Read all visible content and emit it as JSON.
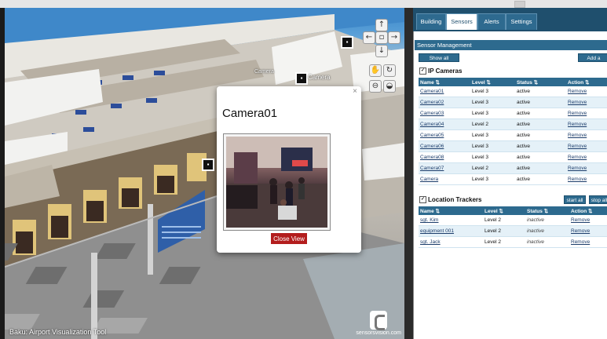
{
  "viewport": {
    "watermark": "Baku: Airport Visualization Tool",
    "brand": "sensorsvision.com",
    "camera_labels": [
      "Camera",
      "Camera",
      "Camera"
    ],
    "nav_icons": [
      "arrow-up-icon",
      "arrow-left-icon",
      "center-icon",
      "arrow-right-icon",
      "arrow-down-icon",
      "hand-icon",
      "rotate-icon",
      "zoom-icon",
      "tilt-icon"
    ]
  },
  "modal": {
    "title": "Camera01",
    "close_glyph": "×",
    "close_view_label": "Close View"
  },
  "tabs": [
    {
      "label": "Building",
      "active": false
    },
    {
      "label": "Sensors",
      "active": true
    },
    {
      "label": "Alerts",
      "active": false
    },
    {
      "label": "Settings",
      "active": false
    }
  ],
  "sensor_management": {
    "title": "Sensor Management",
    "show_all_label": "Show all Sensors",
    "add_label": "Add a Sensor"
  },
  "ip_cameras": {
    "title": "IP Cameras",
    "checked": true,
    "columns": [
      "Name",
      "Level",
      "Status",
      "Action"
    ],
    "rows": [
      {
        "name": "Camera01",
        "level": "Level 3",
        "status": "active",
        "action": "Remove"
      },
      {
        "name": "Camera02",
        "level": "Level 3",
        "status": "active",
        "action": "Remove"
      },
      {
        "name": "Camera03",
        "level": "Level 3",
        "status": "active",
        "action": "Remove"
      },
      {
        "name": "Camera04",
        "level": "Level 2",
        "status": "active",
        "action": "Remove"
      },
      {
        "name": "Camera05",
        "level": "Level 3",
        "status": "active",
        "action": "Remove"
      },
      {
        "name": "Camera06",
        "level": "Level 3",
        "status": "active",
        "action": "Remove"
      },
      {
        "name": "Camera08",
        "level": "Level 3",
        "status": "active",
        "action": "Remove"
      },
      {
        "name": "Camera07",
        "level": "Level 2",
        "status": "active",
        "action": "Remove"
      },
      {
        "name": "Camera",
        "level": "Level 3",
        "status": "active",
        "action": "Remove"
      }
    ]
  },
  "location_trackers": {
    "title": "Location Trackers",
    "checked": true,
    "start_label": "start all",
    "stop_label": "stop all",
    "columns": [
      "Name",
      "Level",
      "Status",
      "Action"
    ],
    "rows": [
      {
        "name": "sgt. Kim",
        "level": "Level 2",
        "status": "inactive",
        "action": "Remove"
      },
      {
        "name": "equipment 001",
        "level": "Level 2",
        "status": "inactive",
        "action": "Remove"
      },
      {
        "name": "sgt. Jack",
        "level": "Level 2",
        "status": "inactive",
        "action": "Remove"
      }
    ]
  },
  "colors": {
    "panel_header": "#1f4f6d",
    "table_header": "#2d6a8e",
    "close_view_button": "#b31d1d"
  }
}
